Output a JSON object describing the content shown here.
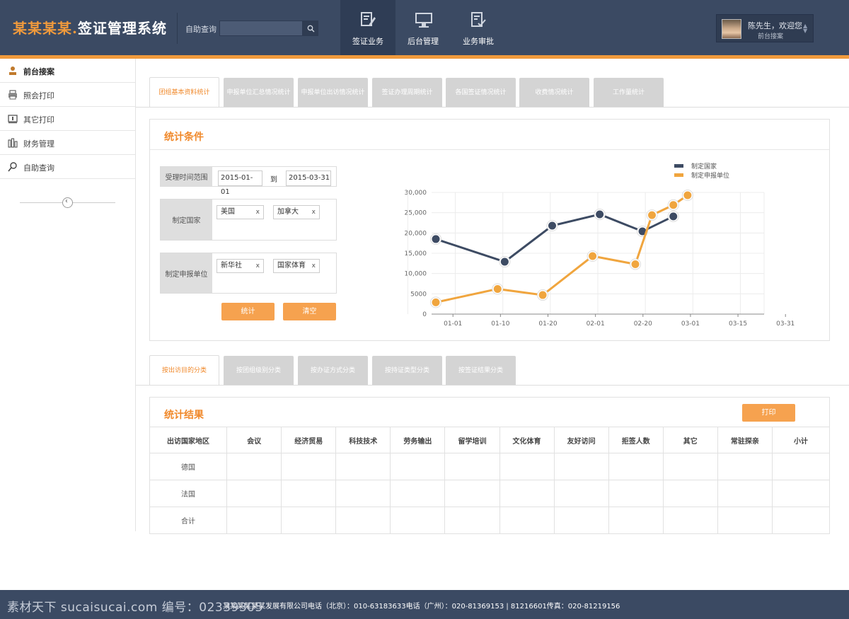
{
  "header": {
    "logo_brand": "某某某某",
    "logo_dot": ".",
    "logo_title": "签证管理系统",
    "search_label": "自助查询",
    "search_placeholder": "",
    "nav": [
      {
        "label": "签证业务",
        "icon": "edit-doc-icon",
        "active": true
      },
      {
        "label": "后台管理",
        "icon": "monitor-icon",
        "active": false
      },
      {
        "label": "业务审批",
        "icon": "approve-doc-icon",
        "active": false
      }
    ],
    "user": {
      "greeting": "陈先生，欢迎您",
      "role": "前台接案"
    }
  },
  "sidebar": {
    "items": [
      {
        "label": "前台接案",
        "icon": "user-stamp-icon",
        "active": true
      },
      {
        "label": "照会打印",
        "icon": "printer-icon",
        "active": false
      },
      {
        "label": "其它打印",
        "icon": "print-screen-icon",
        "active": false
      },
      {
        "label": "财务管理",
        "icon": "finance-icon",
        "active": false
      },
      {
        "label": "自助查询",
        "icon": "search-icon",
        "active": false
      }
    ],
    "collapse_symbol": "‹"
  },
  "top_tabs": [
    {
      "label": "团组基本资料统计",
      "active": true
    },
    {
      "label": "申报单位汇总情况统计",
      "active": false
    },
    {
      "label": "申报单位出访情况统计",
      "active": false
    },
    {
      "label": "签证办理周期统计",
      "active": false
    },
    {
      "label": "各国签证情况统计",
      "active": false
    },
    {
      "label": "收费情况统计",
      "active": false
    },
    {
      "label": "工作量统计",
      "active": false
    }
  ],
  "conditions": {
    "title": "统计条件",
    "time_label": "受理时间范围",
    "date_from": "2015-01-01",
    "to_text": "到",
    "date_to": "2015-03-31",
    "country_label": "制定国家",
    "countries": [
      "美国",
      "加拿大"
    ],
    "unit_label": "制定申报单位",
    "units": [
      "新华社",
      "国家体育"
    ],
    "tag_close": "x",
    "stat_button": "统计",
    "clear_button": "清空"
  },
  "chart_data": {
    "type": "line",
    "x": [
      "01-01",
      "01-10",
      "01-20",
      "02-01",
      "02-20",
      "03-01",
      "03-15",
      "03-31"
    ],
    "ylim": [
      0,
      30000
    ],
    "yticks": [
      "0",
      "5000",
      "10,000",
      "15,000",
      "20,000",
      "25,000",
      "30,000"
    ],
    "grid": true,
    "legend_position": "top-right",
    "series": [
      {
        "name": "制定国家",
        "color": "#3d4b63",
        "points": [
          [
            0.0,
            18500
          ],
          [
            1.45,
            12900
          ],
          [
            2.45,
            21800
          ],
          [
            3.45,
            24600
          ],
          [
            4.35,
            20400
          ],
          [
            5.0,
            24100
          ]
        ]
      },
      {
        "name": "制定申报单位",
        "color": "#f0a53e",
        "points": [
          [
            0.0,
            2900
          ],
          [
            1.3,
            6200
          ],
          [
            2.25,
            4700
          ],
          [
            3.3,
            14300
          ],
          [
            4.2,
            12300
          ],
          [
            4.55,
            24400
          ],
          [
            5.0,
            26900
          ],
          [
            5.3,
            29300
          ]
        ]
      }
    ]
  },
  "bottom_tabs": [
    {
      "label": "按出访目的分类",
      "active": true
    },
    {
      "label": "按团组级别分类",
      "active": false
    },
    {
      "label": "按办证方式分类",
      "active": false
    },
    {
      "label": "按持证类型分类",
      "active": false
    },
    {
      "label": "按签证结果分类",
      "active": false
    }
  ],
  "results": {
    "title": "统计结果",
    "print_button": "打印",
    "columns": [
      "出访国家地区",
      "会议",
      "经济贸易",
      "科技技术",
      "劳务输出",
      "留学培训",
      "文化体育",
      "友好访问",
      "拒签人数",
      "其它",
      "常驻探亲",
      "小计"
    ],
    "rows": [
      [
        "德国",
        "",
        "",
        "",
        "",
        "",
        "",
        "",
        "",
        "",
        "",
        ""
      ],
      [
        "法国",
        "",
        "",
        "",
        "",
        "",
        "",
        "",
        "",
        "",
        "",
        ""
      ],
      [
        "合计",
        "",
        "",
        "",
        "",
        "",
        "",
        "",
        "",
        "",
        "",
        ""
      ]
    ]
  },
  "footer": {
    "text": "某某某某某某发展有限公司电话（北京）：010-63183633电话（广州）：020-81369153 | 81216601传真：020-81219156",
    "watermark": "素材天下 sucaisucai.com   编号：02339305"
  }
}
